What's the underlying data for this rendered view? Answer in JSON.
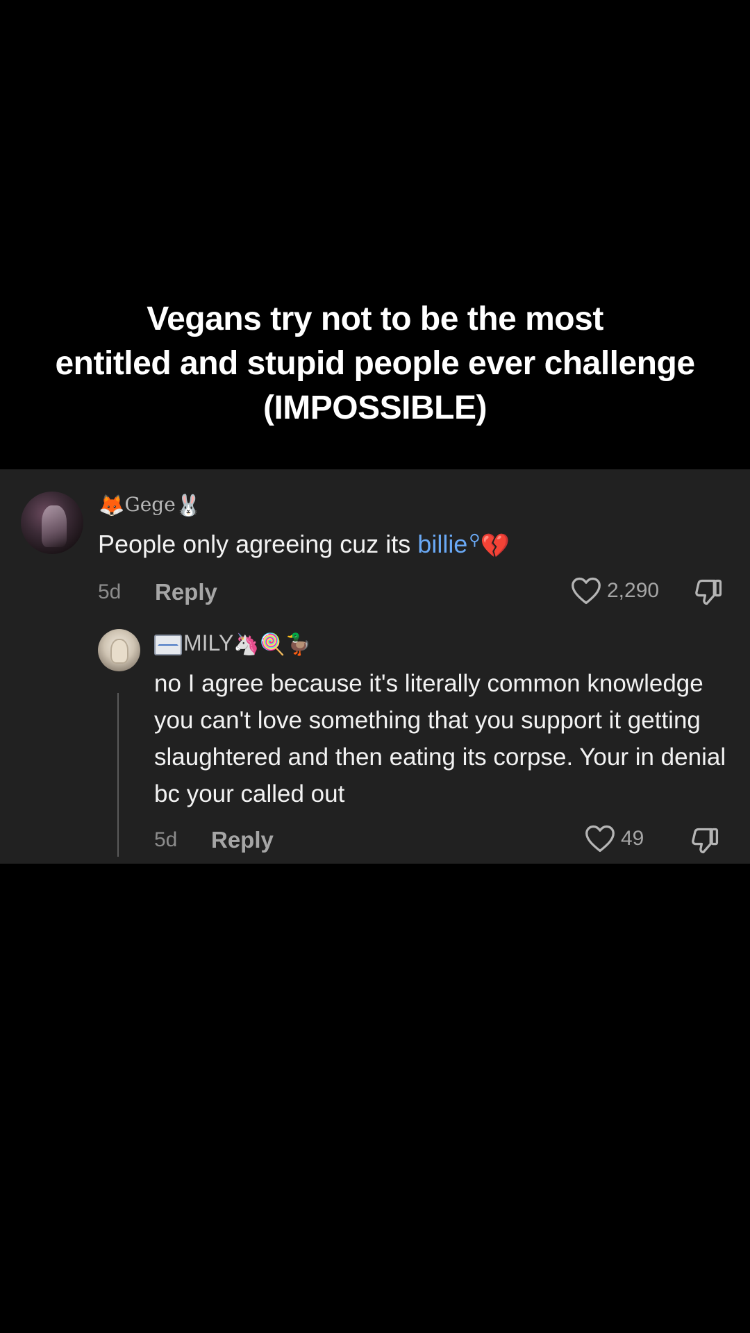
{
  "caption": {
    "line1": "Vegans try not to be the most",
    "line2": "entitled and stupid people ever challenge",
    "line3": "(IMPOSSIBLE)"
  },
  "comment": {
    "username_prefix_emoji": "🦊",
    "username": "Gege",
    "username_suffix_emoji": "🐰",
    "text": "People only agreeing cuz its ",
    "link_text": "billie",
    "trailing_emoji": "💔",
    "time": "5d",
    "reply_label": "Reply",
    "likes": "2,290",
    "avatar_icon": "avatar-image",
    "link_icon": "search-icon"
  },
  "reply": {
    "username": "MILY",
    "username_emojis": "🦄🍭🦆",
    "text": "no I agree because it's literally common knowledge you can't love something that you support it getting slaughtered and then eating its corpse. Your in denial bc your called out",
    "time": "5d",
    "reply_label": "Reply",
    "likes": "49"
  },
  "colors": {
    "background": "#000000",
    "panel": "#212121",
    "link": "#6aa9f5",
    "muted_text": "#8c8c8c"
  }
}
